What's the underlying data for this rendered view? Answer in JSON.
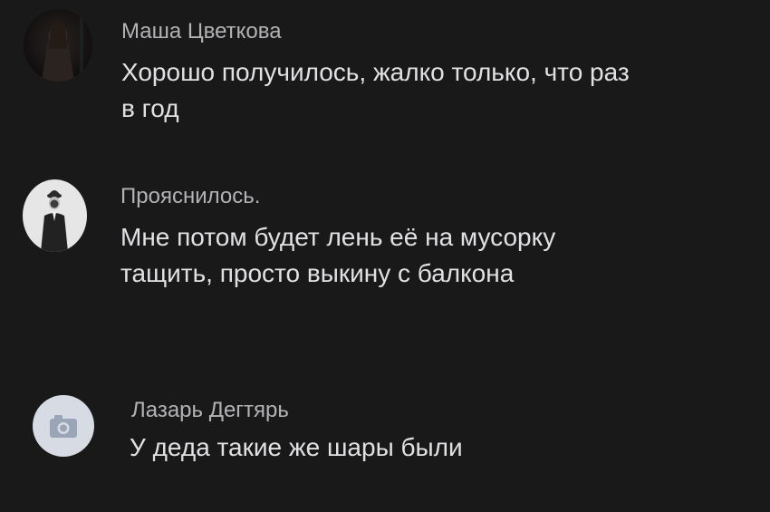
{
  "comments": [
    {
      "author": "Маша Цветкова",
      "lines": [
        "Хорошо получилось, жалко только, что раз",
        "в год"
      ],
      "avatar_icon": "user-photo-icon"
    },
    {
      "author": "Прояснилось.",
      "lines": [
        "Мне потом будет лень её на мусорку",
        "тащить, просто выкину с балкона"
      ],
      "avatar_icon": "man-in-bowler-hat-icon"
    },
    {
      "author": "Лазарь Дегтярь",
      "lines": [
        "У деда такие же шары были"
      ],
      "avatar_icon": "camera-icon"
    }
  ],
  "colors": {
    "background": "#19191a",
    "author_text": "#b3b3b6",
    "comment_text": "#e1e1e3",
    "placeholder_avatar": "#d6dbe4"
  }
}
